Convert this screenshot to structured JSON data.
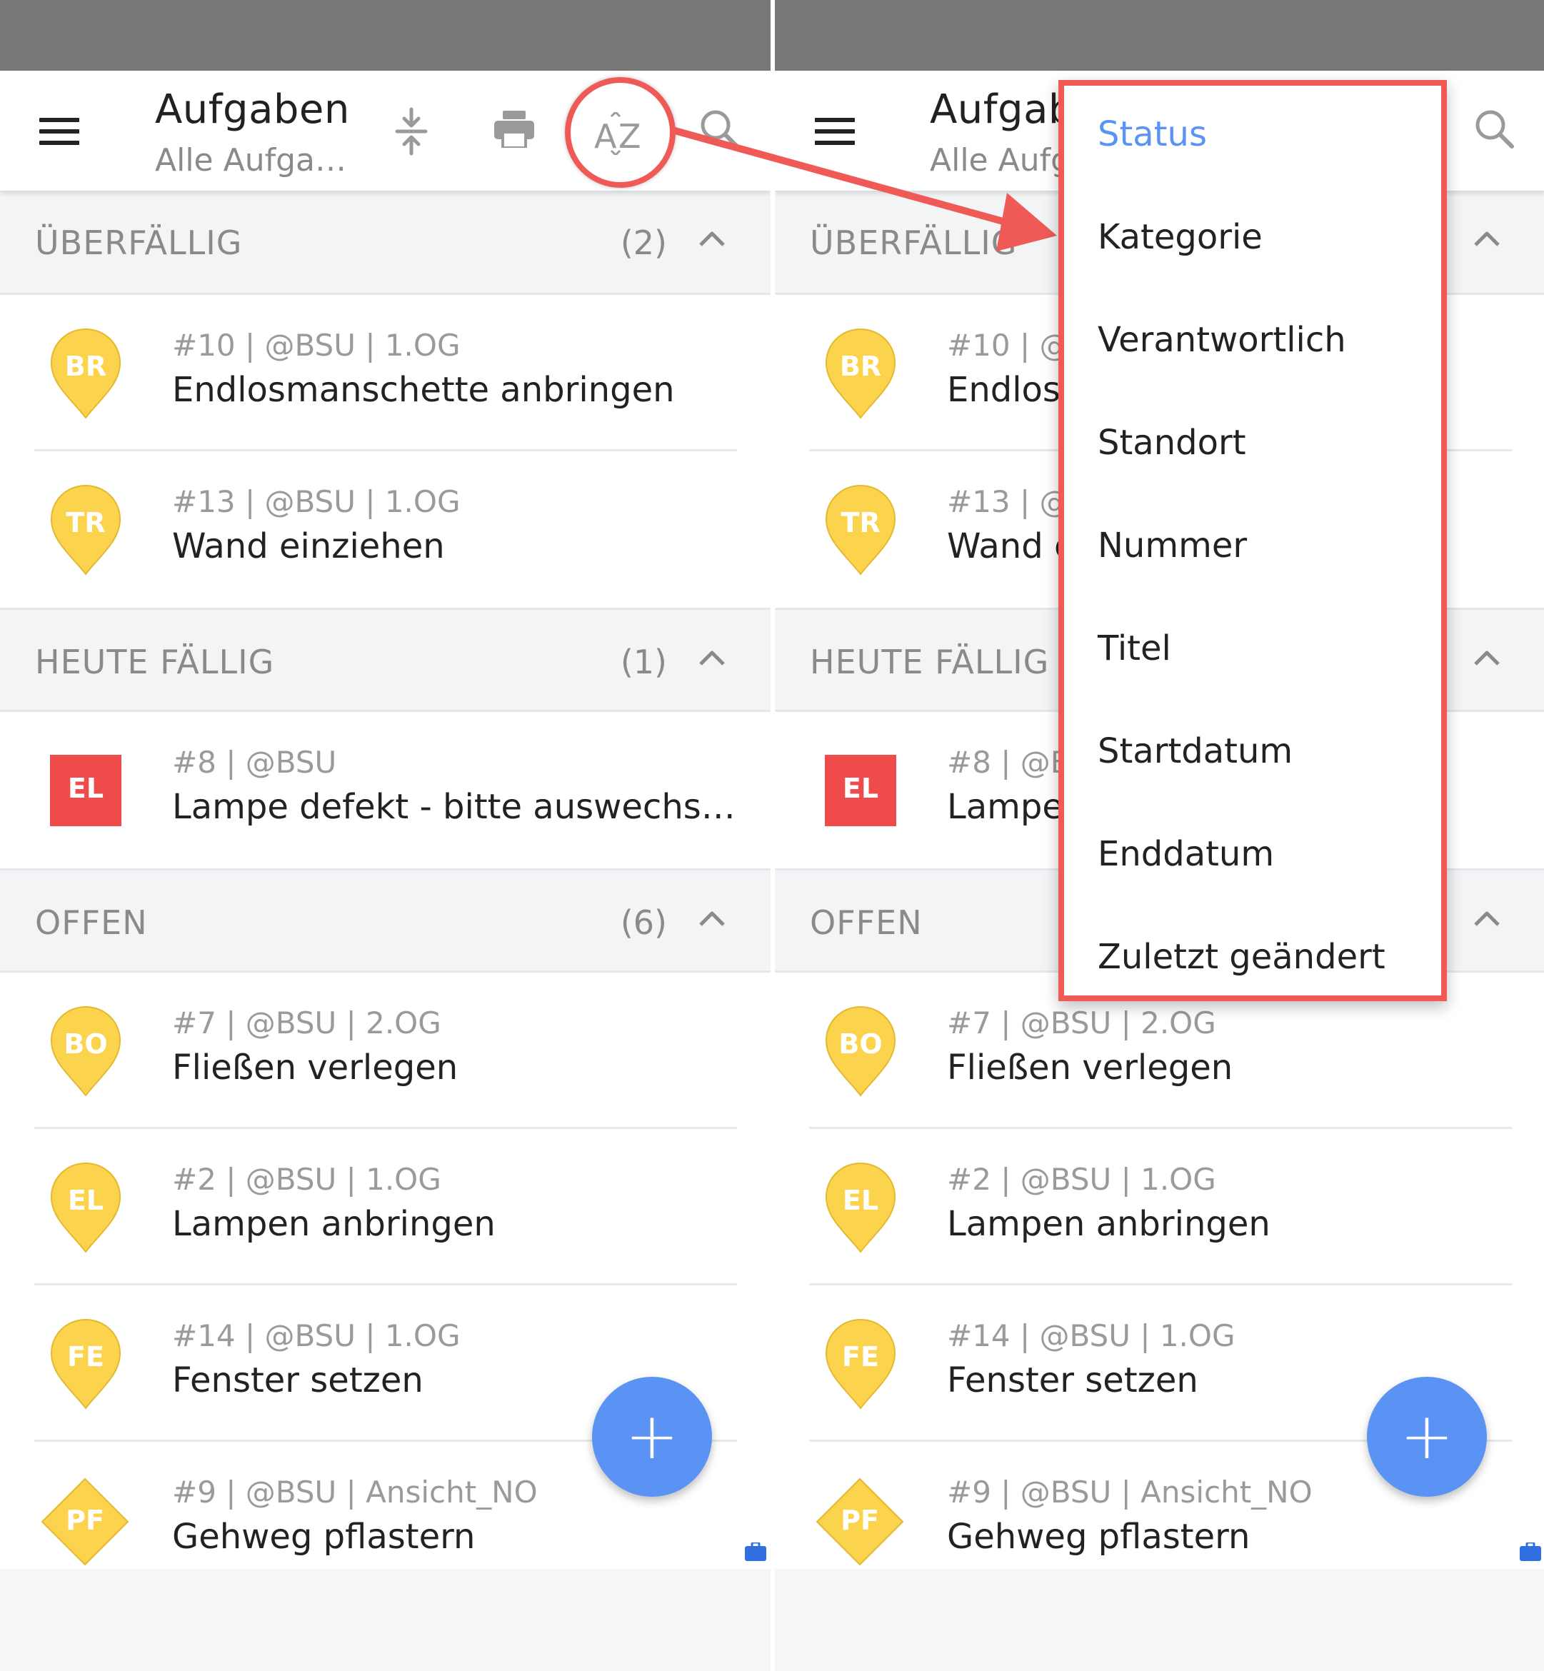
{
  "app_bar": {
    "title": "Aufgaben",
    "subtitle": "Alle Aufga…",
    "title_clipped": "Aufgab",
    "subtitle_clipped": "Alle Aufg",
    "sort_icon_text": "AZ"
  },
  "sections": [
    {
      "title": "ÜBERFÄLLIG",
      "count": "(2)",
      "tasks": [
        {
          "badge": "BR",
          "shape": "pin",
          "meta": "#10 | @BSU | 1.OG",
          "title": "Endlosmanschette anbringen",
          "meta_clip": "#10 | @I",
          "title_clip": "Endlosi"
        },
        {
          "badge": "TR",
          "shape": "pin",
          "meta": "#13 | @BSU | 1.OG",
          "title": "Wand einziehen",
          "meta_clip": "#13 | @I",
          "title_clip": "Wand e"
        }
      ]
    },
    {
      "title": "HEUTE FÄLLIG",
      "count": "(1)",
      "tasks": [
        {
          "badge": "EL",
          "shape": "square",
          "meta": "#8 | @BSU",
          "title": "Lampe defekt - bitte auswechs…",
          "meta_clip": "#8 | @BS",
          "title_clip": "Lampe"
        }
      ]
    },
    {
      "title": "OFFEN",
      "count": "(6)",
      "tasks": [
        {
          "badge": "BO",
          "shape": "pin",
          "meta": "#7 | @BSU | 2.OG",
          "title": "Fließen verlegen"
        },
        {
          "badge": "EL",
          "shape": "pin",
          "meta": "#2 | @BSU | 1.OG",
          "title": "Lampen anbringen"
        },
        {
          "badge": "FE",
          "shape": "pin",
          "meta": "#14 | @BSU | 1.OG",
          "title": "Fenster setzen"
        },
        {
          "badge": "PF",
          "shape": "diamond",
          "meta": "#9 | @BSU | Ansicht_NO",
          "title": "Gehweg pflastern"
        }
      ]
    }
  ],
  "fab": {
    "label": "+"
  },
  "sort_menu": {
    "selected": "Status",
    "items": [
      "Status",
      "Kategorie",
      "Verantwortlich",
      "Standort",
      "Nummer",
      "Titel",
      "Startdatum",
      "Enddatum",
      "Zuletzt geändert"
    ]
  },
  "colors": {
    "accent": "#5b93f5",
    "overdue_badge": "#fcd34d",
    "category_red": "#f04b4b",
    "annotation": "#ef5a57",
    "status_bar": "#777777"
  }
}
